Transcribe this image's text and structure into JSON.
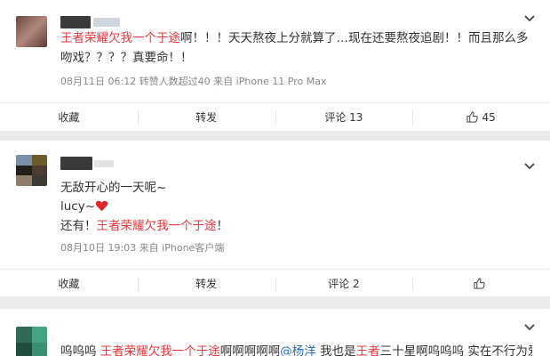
{
  "posts": [
    {
      "highlight": "王者荣耀欠我一个于途",
      "text_after": "啊！！！天天熬夜上分就算了…现在还要熬夜追剧！！而且那么多吻戏？？？？真要命！！",
      "meta": "08月11日 06:12 转赞人数超过40 来自 iPhone 11 Pro Max",
      "actions": {
        "collect": "收藏",
        "repost": "转发",
        "comment": "评论 13",
        "like": "45"
      }
    },
    {
      "line1": "无敌开心的一天呢~",
      "line2_prefix": "lucy~",
      "line3_prefix": "还有！",
      "line3_highlight": "王者荣耀欠我一个于途",
      "line3_suffix": "！",
      "meta": "08月10日 19:03 来自 iPhone客户端",
      "actions": {
        "collect": "收藏",
        "repost": "转发",
        "comment": "评论 2",
        "like": ""
      }
    },
    {
      "t1": "呜呜呜 ",
      "t2": "王者荣耀欠我一个于途",
      "t3": "啊啊啊啊啊",
      "t4": "@杨洋",
      "t5": " 我也是",
      "t6": "王者",
      "t7": "三十星啊呜呜呜 实在不行为爱肝"
    }
  ],
  "colors": {
    "highlight": "#e8383d",
    "mention": "#2d6fb8",
    "heart": "#e0242c"
  },
  "icons": [
    "chevron-down-icon",
    "thumbs-up-icon",
    "heart-icon"
  ]
}
